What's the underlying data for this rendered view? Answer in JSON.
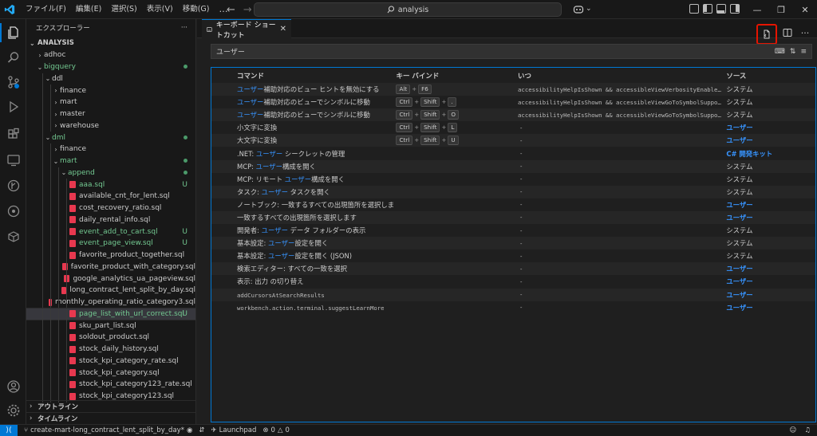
{
  "titlebar": {
    "menus": [
      "ファイル(F)",
      "編集(E)",
      "選択(S)",
      "表示(V)",
      "移動(G)",
      "…"
    ],
    "search_text": "analysis"
  },
  "sidebar": {
    "header": "エクスプローラー",
    "root": "ANALYSIS",
    "tree": [
      {
        "label": "adhoc",
        "depth": 0,
        "type": "folder",
        "expanded": false,
        "status": ""
      },
      {
        "label": "bigquery",
        "depth": 0,
        "type": "folder",
        "expanded": true,
        "status": "dot",
        "color": "#73c991"
      },
      {
        "label": "ddl",
        "depth": 1,
        "type": "folder",
        "expanded": true,
        "status": ""
      },
      {
        "label": "finance",
        "depth": 2,
        "type": "folder",
        "expanded": false,
        "status": ""
      },
      {
        "label": "mart",
        "depth": 2,
        "type": "folder",
        "expanded": false,
        "status": ""
      },
      {
        "label": "master",
        "depth": 2,
        "type": "folder",
        "expanded": false,
        "status": ""
      },
      {
        "label": "warehouse",
        "depth": 2,
        "type": "folder",
        "expanded": false,
        "status": ""
      },
      {
        "label": "dml",
        "depth": 1,
        "type": "folder",
        "expanded": true,
        "status": "dot",
        "color": "#73c991"
      },
      {
        "label": "finance",
        "depth": 2,
        "type": "folder",
        "expanded": false,
        "status": ""
      },
      {
        "label": "mart",
        "depth": 2,
        "type": "folder",
        "expanded": true,
        "status": "dot",
        "color": "#73c991"
      },
      {
        "label": "append",
        "depth": 3,
        "type": "folder",
        "expanded": true,
        "status": "dot",
        "color": "#73c991"
      },
      {
        "label": "aaa.sql",
        "depth": 4,
        "type": "file",
        "status": "U",
        "color": "#73c991"
      },
      {
        "label": "available_cnt_for_lent.sql",
        "depth": 4,
        "type": "file",
        "status": ""
      },
      {
        "label": "cost_recovery_ratio.sql",
        "depth": 4,
        "type": "file",
        "status": ""
      },
      {
        "label": "daily_rental_info.sql",
        "depth": 4,
        "type": "file",
        "status": ""
      },
      {
        "label": "event_add_to_cart.sql",
        "depth": 4,
        "type": "file",
        "status": "U",
        "color": "#73c991"
      },
      {
        "label": "event_page_view.sql",
        "depth": 4,
        "type": "file",
        "status": "U",
        "color": "#73c991"
      },
      {
        "label": "favorite_product_together.sql",
        "depth": 4,
        "type": "file",
        "status": ""
      },
      {
        "label": "favorite_product_with_category.sql",
        "depth": 4,
        "type": "file",
        "status": ""
      },
      {
        "label": "google_analytics_ua_pageview.sql",
        "depth": 4,
        "type": "file",
        "status": ""
      },
      {
        "label": "long_contract_lent_split_by_day.sql",
        "depth": 4,
        "type": "file",
        "status": ""
      },
      {
        "label": "monthly_operating_ratio_category3.sql",
        "depth": 4,
        "type": "file",
        "status": ""
      },
      {
        "label": "page_list_with_url_correct.sql",
        "depth": 4,
        "type": "file",
        "status": "U",
        "color": "#73c991",
        "selected": true
      },
      {
        "label": "sku_part_list.sql",
        "depth": 4,
        "type": "file",
        "status": ""
      },
      {
        "label": "soldout_product.sql",
        "depth": 4,
        "type": "file",
        "status": ""
      },
      {
        "label": "stock_daily_history.sql",
        "depth": 4,
        "type": "file",
        "status": ""
      },
      {
        "label": "stock_kpi_category_rate.sql",
        "depth": 4,
        "type": "file",
        "status": ""
      },
      {
        "label": "stock_kpi_category.sql",
        "depth": 4,
        "type": "file",
        "status": ""
      },
      {
        "label": "stock_kpi_category123_rate.sql",
        "depth": 4,
        "type": "file",
        "status": ""
      },
      {
        "label": "stock_kpi_category123.sql",
        "depth": 4,
        "type": "file",
        "status": ""
      }
    ],
    "outline_label": "アウトライン",
    "timeline_label": "タイムライン"
  },
  "editor": {
    "tab_title": "キーボード ショートカット",
    "search_value": "ユーザー",
    "columns": {
      "command": "コマンド",
      "keybinding": "キー バインド",
      "when": "いつ",
      "source": "ソース"
    },
    "rows": [
      {
        "command": [
          [
            "hl",
            "ユーザー"
          ],
          [
            "n",
            "補助対応のビュー ヒントを無効にする"
          ]
        ],
        "keys": [
          "Alt",
          "F6"
        ],
        "when": "accessibilityHelpIsShown && accessibleViewVerbosityEnabled …",
        "source": "システム",
        "source_type": "sys"
      },
      {
        "command": [
          [
            "hl",
            "ユーザー"
          ],
          [
            "n",
            "補助対応のビューでシンボルに移動"
          ]
        ],
        "keys": [
          "Ctrl",
          "Shift",
          "."
        ],
        "when": "accessibilityHelpIsShown && accessibleViewGoToSymbolSupport…",
        "source": "システム",
        "source_type": "sys"
      },
      {
        "command": [
          [
            "hl",
            "ユーザー"
          ],
          [
            "n",
            "補助対応のビューでシンボルに移動"
          ]
        ],
        "keys": [
          "Ctrl",
          "Shift",
          "O"
        ],
        "when": "accessibilityHelpIsShown && accessibleViewGoToSymbolSupport…",
        "source": "システム",
        "source_type": "sys"
      },
      {
        "command": [
          [
            "n",
            "小文字に変換"
          ]
        ],
        "keys": [
          "Ctrl",
          "Shift",
          "L"
        ],
        "when": "-",
        "source": "ユーザー",
        "source_type": "user"
      },
      {
        "command": [
          [
            "n",
            "大文字に変換"
          ]
        ],
        "keys": [
          "Ctrl",
          "Shift",
          "U"
        ],
        "when": "-",
        "source": "ユーザー",
        "source_type": "user"
      },
      {
        "command": [
          [
            "n",
            ".NET: "
          ],
          [
            "hl",
            "ユーザー"
          ],
          [
            "n",
            " シークレットの管理"
          ]
        ],
        "keys": [],
        "when": "-",
        "source": "C# 開発キット",
        "source_type": "ext"
      },
      {
        "command": [
          [
            "n",
            "MCP: "
          ],
          [
            "hl",
            "ユーザー"
          ],
          [
            "n",
            "構成を開く"
          ]
        ],
        "keys": [],
        "when": "-",
        "source": "システム",
        "source_type": "sys"
      },
      {
        "command": [
          [
            "n",
            "MCP: リモート "
          ],
          [
            "hl",
            "ユーザー"
          ],
          [
            "n",
            "構成を開く"
          ]
        ],
        "keys": [],
        "when": "-",
        "source": "システム",
        "source_type": "sys"
      },
      {
        "command": [
          [
            "n",
            "タスク: "
          ],
          [
            "hl",
            "ユーザー"
          ],
          [
            "n",
            " タスクを開く"
          ]
        ],
        "keys": [],
        "when": "-",
        "source": "システム",
        "source_type": "sys"
      },
      {
        "command": [
          [
            "n",
            "ノートブック: 一致するすべての出現箇所を選択します"
          ]
        ],
        "keys": [],
        "when": "-",
        "source": "ユーザー",
        "source_type": "user"
      },
      {
        "command": [
          [
            "n",
            "一致するすべての出現箇所を選択します"
          ]
        ],
        "keys": [],
        "when": "-",
        "source": "ユーザー",
        "source_type": "user"
      },
      {
        "command": [
          [
            "n",
            "開発者: "
          ],
          [
            "hl",
            "ユーザー"
          ],
          [
            "n",
            " データ フォルダーの表示"
          ]
        ],
        "keys": [],
        "when": "-",
        "source": "システム",
        "source_type": "sys"
      },
      {
        "command": [
          [
            "n",
            "基本設定: "
          ],
          [
            "hl",
            "ユーザー"
          ],
          [
            "n",
            "設定を開く"
          ]
        ],
        "keys": [],
        "when": "-",
        "source": "システム",
        "source_type": "sys"
      },
      {
        "command": [
          [
            "n",
            "基本設定: "
          ],
          [
            "hl",
            "ユーザー"
          ],
          [
            "n",
            "設定を開く (JSON)"
          ]
        ],
        "keys": [],
        "when": "-",
        "source": "システム",
        "source_type": "sys"
      },
      {
        "command": [
          [
            "n",
            "検索エディター: すべての一致を選択"
          ]
        ],
        "keys": [],
        "when": "-",
        "source": "ユーザー",
        "source_type": "user"
      },
      {
        "command": [
          [
            "n",
            "表示: 出力 の切り替え"
          ]
        ],
        "keys": [],
        "when": "-",
        "source": "ユーザー",
        "source_type": "user"
      },
      {
        "command": [
          [
            "m",
            "addCursorsAtSearchResults"
          ]
        ],
        "keys": [],
        "when": "-",
        "source": "ユーザー",
        "source_type": "user"
      },
      {
        "command": [
          [
            "m",
            "workbench.action.terminal.suggestLearnMore"
          ]
        ],
        "keys": [],
        "when": "-",
        "source": "ユーザー",
        "source_type": "user"
      }
    ]
  },
  "statusbar": {
    "branch": "create-mart-long_contract_lent_split_by_day*",
    "launchpad": "Launchpad",
    "errors": "0",
    "warnings": "0"
  },
  "colors": {
    "accent": "#0078d4",
    "highlight_box": "#e51400",
    "user_text": "#3794ff",
    "git_untracked": "#73c991",
    "sql_icon": "#e8384f"
  }
}
